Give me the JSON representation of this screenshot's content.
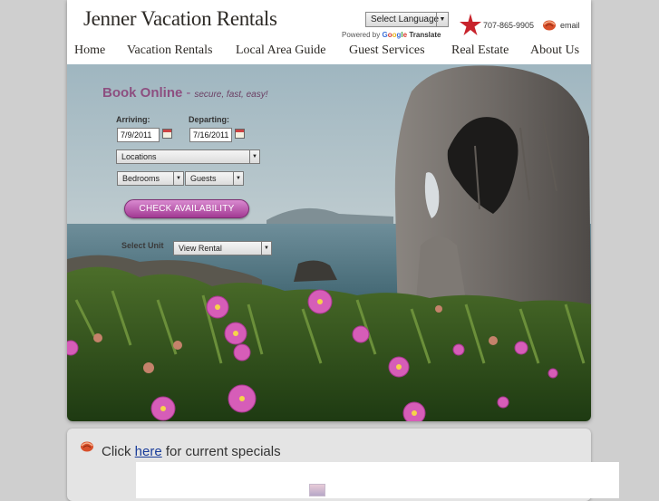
{
  "header": {
    "logo_text": "Jenner Vacation Rentals",
    "language_select": "Select Language",
    "powered_by": "Powered by",
    "google": "Google",
    "translate": "Translate",
    "phone": "707-865-9905",
    "email": "email"
  },
  "nav": {
    "items": [
      {
        "label": "Home"
      },
      {
        "label": "Vacation Rentals"
      },
      {
        "label": "Local Area Guide"
      },
      {
        "label": "Guest Services"
      },
      {
        "label": "Real Estate"
      },
      {
        "label": "About Us"
      }
    ]
  },
  "booking": {
    "title": "Book Online",
    "separator": "-",
    "tagline": "secure, fast, easy!",
    "arriving_label": "Arriving:",
    "arriving_value": "7/9/2011",
    "departing_label": "Departing:",
    "departing_value": "7/16/2011",
    "locations": "Locations",
    "bedrooms": "Bedrooms",
    "guests": "Guests",
    "check_button": "CHECK AVAILABILITY",
    "select_unit_label": "Select Unit",
    "view_rental": "View Rental"
  },
  "specials": {
    "prefix": "Click",
    "link": "here",
    "suffix": "for current specials"
  },
  "colors": {
    "accent": "#8d4f80",
    "button": "#b54aa6",
    "link": "#1a3d9a"
  },
  "icons": [
    "star-icon",
    "email-icon",
    "calendar-icon",
    "dropdown-arrow-icon",
    "flower-icon"
  ]
}
